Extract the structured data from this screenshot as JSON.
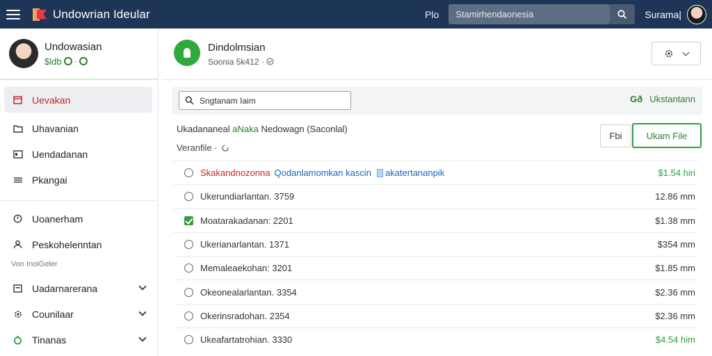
{
  "app": {
    "title": "Undowrian Ideular"
  },
  "topbar": {
    "link": "Plo",
    "search_value": "Stamirhendaonesia",
    "user_name": "Surama|"
  },
  "profile": {
    "name": "Undowasian",
    "status": "$ldb"
  },
  "sidebar": {
    "items": [
      {
        "label": "Uevakan",
        "icon": "calendar-icon"
      },
      {
        "label": "Uhavanian",
        "icon": "folder-icon"
      },
      {
        "label": "Uendadanan",
        "icon": "contact-card-icon"
      },
      {
        "label": "Pkangai",
        "icon": "list-icon"
      },
      {
        "label": "Uoanerham",
        "icon": "clock-icon"
      },
      {
        "label": "Peskohelenntan",
        "icon": "person-icon"
      }
    ],
    "section_label": "Von  InoiGeler",
    "groups": [
      {
        "label": "Uadarnarerana",
        "icon": "image-icon"
      },
      {
        "label": "Counilaar",
        "icon": "settings-icon"
      },
      {
        "label": "Tinanas",
        "icon": "money-icon"
      }
    ]
  },
  "contact": {
    "name": "Dindolmsian",
    "sub": "Soonia 5k412 ·"
  },
  "toolbar": {
    "filter_placeholder": "Sngtanam Iaim",
    "right_label": "Ukstantann",
    "right_icon": "Gð"
  },
  "info": {
    "prefix": "Ukadananeal",
    "highlight": "aNaka",
    "suffix": "Nedowagn (Saconlal)",
    "line2": "Veranfile  ·",
    "btn_small": "Fbi",
    "btn_primary": "Ukam File"
  },
  "rows": [
    {
      "red": "Skakandnozonna",
      "blue": "Qodanlamomkan kascin",
      "blue2": "akatertananpik",
      "amount": "$1.54 hiri",
      "green": true
    },
    {
      "text": "Ukerundiarlantan. 3759",
      "amount": "12.86 mm",
      "green": false
    },
    {
      "text": "Moatarakadanan: 2201",
      "amount": "$1.38 mm",
      "green": false,
      "checked": true
    },
    {
      "text": "Ukerianarlantan. 1371",
      "amount": "$354 mm",
      "green": false
    },
    {
      "text": "Memaleaekohan: 3201",
      "amount": "$1.85 mm",
      "green": false
    },
    {
      "text": "Okeonealarlantan. 3354",
      "amount": "$2.36 mm",
      "green": false
    },
    {
      "text": "Okerinsradohan. 2354",
      "amount": "$2.36 mm",
      "green": false
    },
    {
      "text": "Ukeafartatrohian. 3330",
      "amount": "$4.54 him",
      "green": true
    }
  ],
  "colors": {
    "topbar": "#1d3557",
    "accent_green": "#2e9e3f",
    "active_red": "#c62828"
  }
}
